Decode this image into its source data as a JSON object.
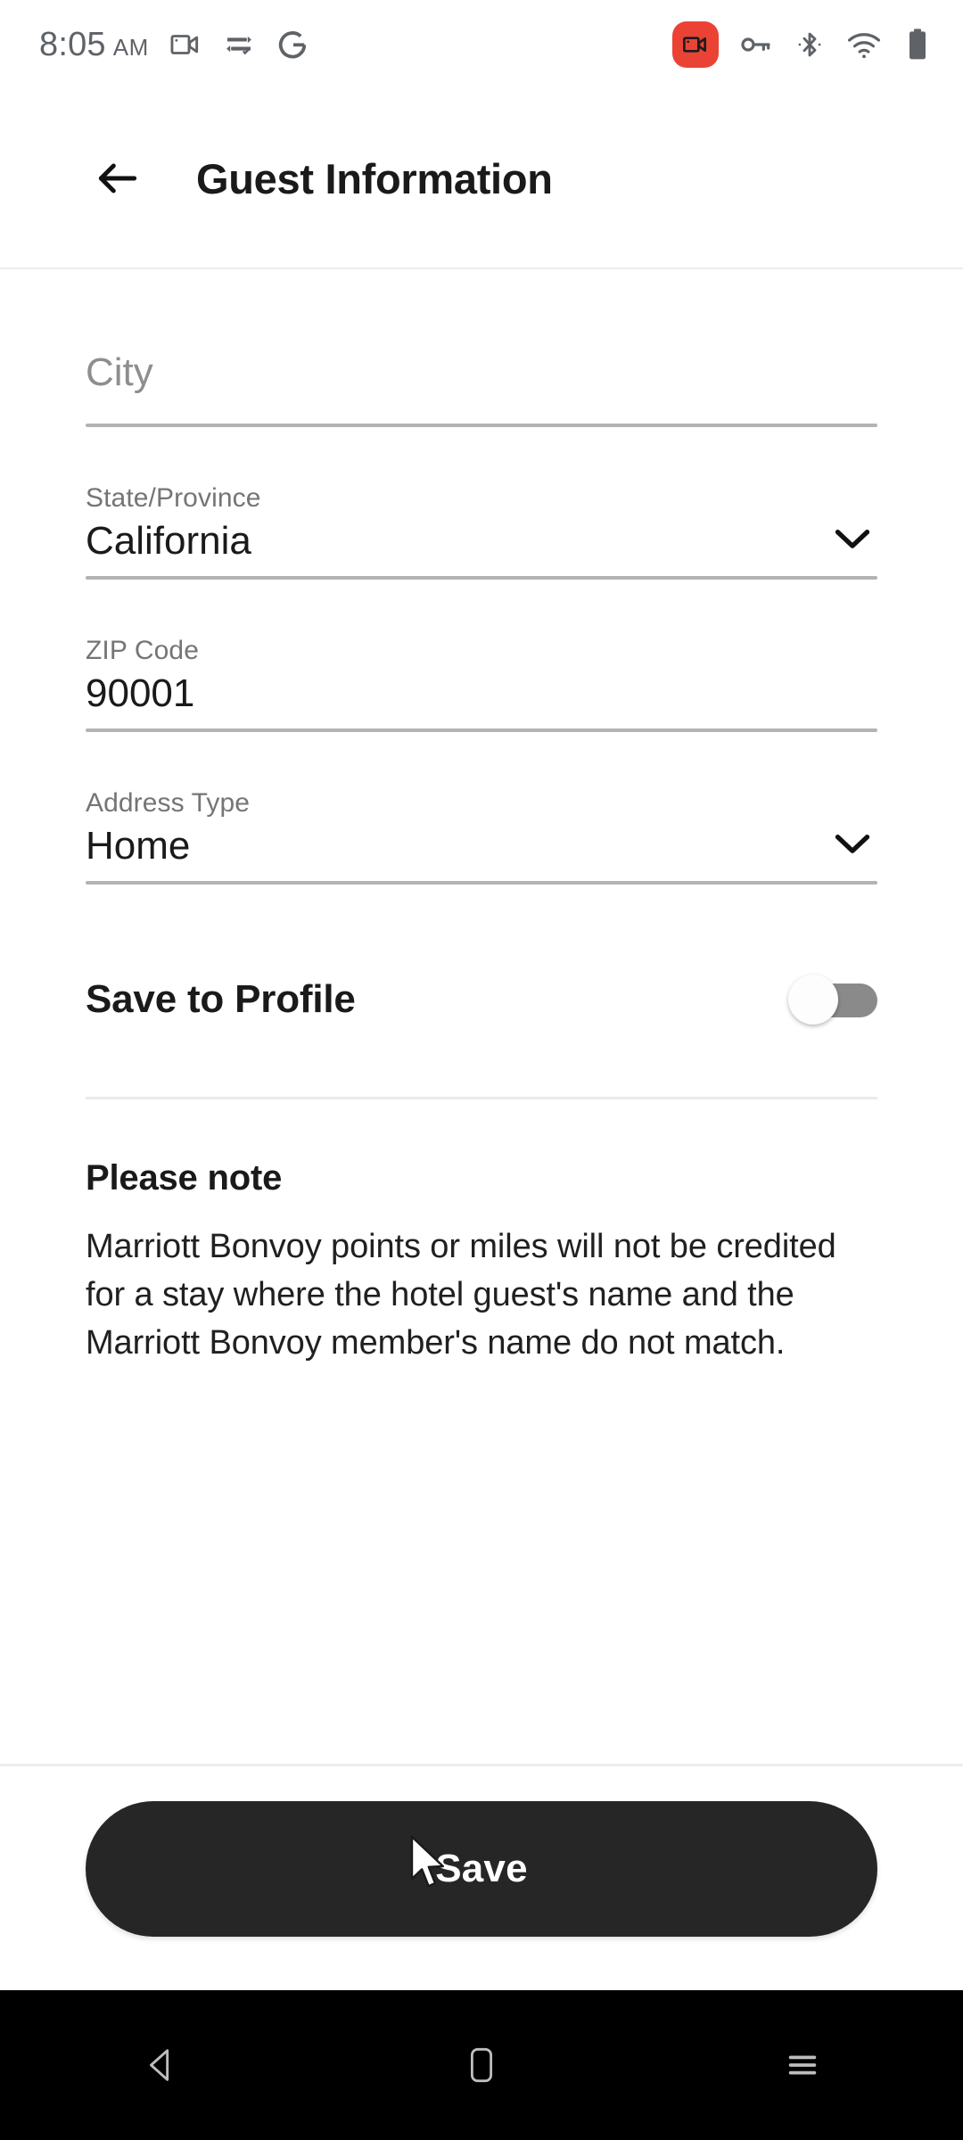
{
  "status_bar": {
    "time": "8:05",
    "ampm": "AM",
    "left_icons": [
      "video-camera-icon",
      "vpn-key-sync-icon",
      "google-g-icon"
    ],
    "right_icons": [
      "screen-recording-badge-icon",
      "vpn-key-icon",
      "bluetooth-icon",
      "wifi-icon",
      "battery-icon"
    ],
    "recording_badge_color": "#ea4335"
  },
  "header": {
    "back_label": "back-arrow",
    "title": "Guest Information"
  },
  "form": {
    "city": {
      "label": "",
      "placeholder": "City",
      "value": ""
    },
    "state": {
      "label": "State/Province",
      "value": "California",
      "has_dropdown": true
    },
    "zip": {
      "label": "ZIP Code",
      "value": "90001"
    },
    "address_type": {
      "label": "Address Type",
      "value": "Home",
      "has_dropdown": true
    }
  },
  "save_to_profile": {
    "label": "Save to Profile",
    "enabled": false
  },
  "note": {
    "title": "Please note",
    "body": "Marriott Bonvoy points or miles will not be credited for a stay where the hotel guest's name and the Marriott Bonvoy member's name do not match."
  },
  "footer": {
    "save_label": "Save",
    "save_bg_color": "#262626"
  },
  "nav_bar": {
    "back": "triangle-back-icon",
    "home": "home-square-icon",
    "recents": "recents-lines-icon"
  }
}
